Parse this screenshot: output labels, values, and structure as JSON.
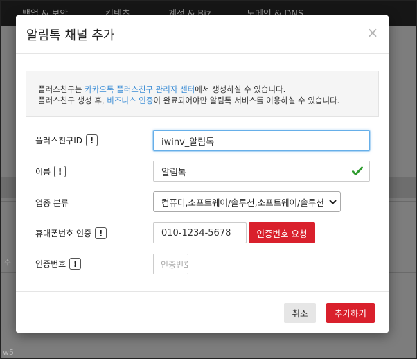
{
  "background": {
    "nav": [
      "백업 & 보안",
      "컨텐츠",
      "계정 & Biz",
      "도메인 & DNS"
    ],
    "partial_texts": {
      "left_middle": "수",
      "bottom_left": "w5"
    }
  },
  "modal": {
    "title": "알림톡 채널 추가",
    "close_symbol": "×",
    "notice": {
      "line1": {
        "link": "카카오톡 플러스친구 관리자 센터",
        "prefix": "플러스친구는 ",
        "suffix": "에서 생성하실 수 있습니다."
      },
      "line2": {
        "prefix": "플러스친구 생성 후, ",
        "link": "비즈니스 인증",
        "suffix": "이 완료되어야만 알림톡 서비스를 이용하실 수 있습니다."
      }
    },
    "fields": {
      "plusfriend_id": {
        "label": "플러스친구ID",
        "info": "!",
        "value": "iwinv_알림톡"
      },
      "name": {
        "label": "이름",
        "info": "!",
        "value": "알림톡"
      },
      "industry": {
        "label": "업종 분류",
        "selected": "컴퓨터,소프트웨어/솔루션,소프트웨어/솔루션"
      },
      "phone": {
        "label": "휴대폰번호 인증",
        "info": "!",
        "value": "010-1234-5678",
        "button": "인증번호 요청"
      },
      "verify_code": {
        "label": "인증번호",
        "info": "!",
        "placeholder": "인증번호"
      }
    },
    "footer": {
      "cancel": "취소",
      "submit": "추가하기"
    }
  },
  "colors": {
    "accent_red": "#d9202c",
    "link_blue": "#3d8ed6",
    "check_green": "#2e9b2e"
  }
}
